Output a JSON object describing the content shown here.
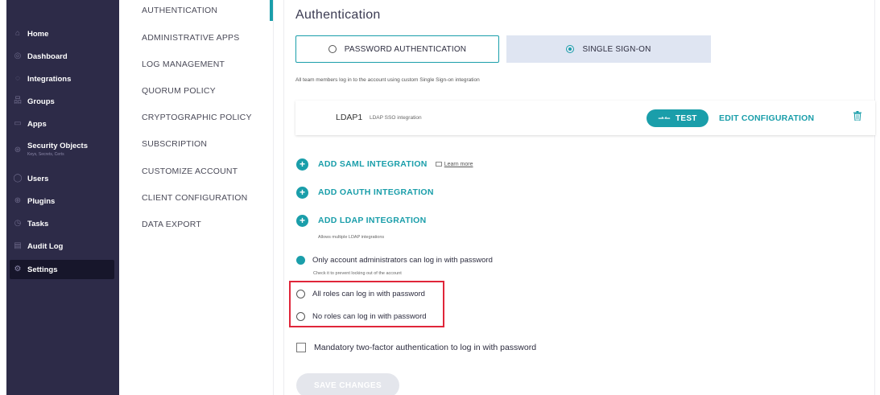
{
  "sidebar": {
    "items": [
      {
        "label": "Home",
        "icon": "home-icon"
      },
      {
        "label": "Dashboard",
        "icon": "dashboard-icon"
      },
      {
        "label": "Integrations",
        "icon": "integrations-icon"
      },
      {
        "label": "Groups",
        "icon": "groups-icon"
      },
      {
        "label": "Apps",
        "icon": "apps-icon"
      },
      {
        "label": "Security Objects",
        "sublabel": "Keys, Secrets, Certs",
        "icon": "security-objects-icon"
      },
      {
        "label": "Users",
        "icon": "users-icon"
      },
      {
        "label": "Plugins",
        "icon": "plugins-icon"
      },
      {
        "label": "Tasks",
        "icon": "tasks-icon"
      },
      {
        "label": "Audit Log",
        "icon": "audit-log-icon"
      },
      {
        "label": "Settings",
        "icon": "gear-icon",
        "active": true
      }
    ]
  },
  "submenu": {
    "items": [
      {
        "label": "AUTHENTICATION",
        "active": true
      },
      {
        "label": "ADMINISTRATIVE APPS"
      },
      {
        "label": "LOG MANAGEMENT"
      },
      {
        "label": "QUORUM POLICY"
      },
      {
        "label": "CRYPTOGRAPHIC POLICY"
      },
      {
        "label": "SUBSCRIPTION"
      },
      {
        "label": "CUSTOMIZE ACCOUNT"
      },
      {
        "label": "CLIENT CONFIGURATION"
      },
      {
        "label": "DATA EXPORT"
      }
    ]
  },
  "main": {
    "title": "Authentication",
    "auth_options": {
      "password": "PASSWORD AUTHENTICATION",
      "sso": "SINGLE SIGN-ON",
      "selected": "sso"
    },
    "description": "All team members log in to the account using custom Single Sign-on integration",
    "ldap": {
      "name": "LDAP1",
      "subtitle": "LDAP SSO integration",
      "test_label": "TEST",
      "edit_label": "EDIT CONFIGURATION"
    },
    "add_saml": "ADD SAML INTEGRATION",
    "learn_more": "Learn more",
    "add_oauth": "ADD OAUTH INTEGRATION",
    "add_ldap": "ADD LDAP INTEGRATION",
    "ldap_note": "Allows multiple LDAP integrations",
    "password_options": [
      {
        "label": "Only account administrators can log in with password",
        "selected": true,
        "sublabel": "Check it to prevent locking out of the account"
      },
      {
        "label": "All roles can log in with password",
        "selected": false
      },
      {
        "label": "No roles can log in with password",
        "selected": false
      }
    ],
    "two_factor_label": "Mandatory two-factor authentication to log in with password",
    "two_factor_checked": false,
    "save_label": "SAVE CHANGES"
  },
  "colors": {
    "accent": "#1a9eaa",
    "sidebar_bg": "#2d2b48",
    "highlight": "#e0263a"
  }
}
